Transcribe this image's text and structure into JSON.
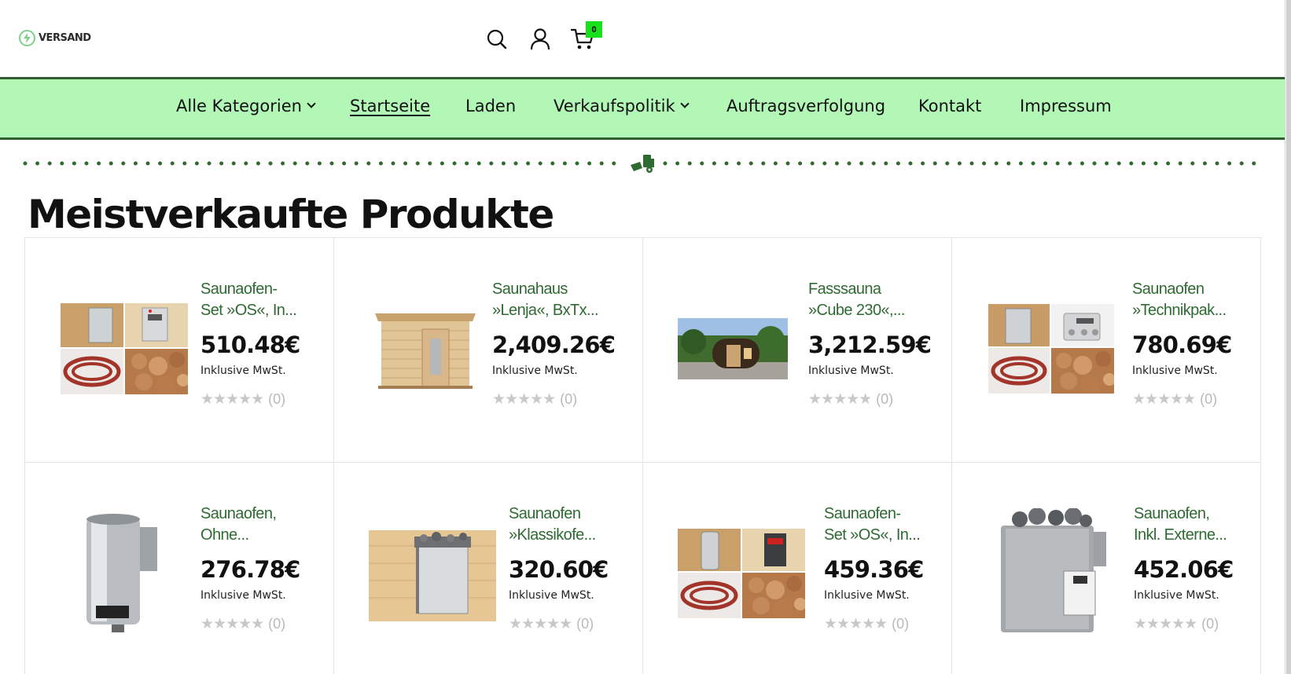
{
  "header": {
    "logo_text": "VERSAND",
    "cart_count": "0"
  },
  "nav": {
    "items": [
      {
        "label": "Alle Kategorien",
        "dropdown": true
      },
      {
        "label": "Startseite",
        "active": true
      },
      {
        "label": "Laden"
      },
      {
        "label": "Verkaufspolitik",
        "dropdown": true
      },
      {
        "label": "Auftragsverfolgung"
      },
      {
        "label": "Kontakt"
      },
      {
        "label": "Impressum"
      }
    ]
  },
  "section": {
    "title": "Meistverkaufte Produkte"
  },
  "products": [
    {
      "name": "Saunaofen-\nSet »OS«, In...",
      "price": "510.48€",
      "tax": "Inklusive MwSt.",
      "stars": "★★★★★",
      "reviews": "(0)"
    },
    {
      "name": "Saunahaus\n»Lenja«, BxTx...",
      "price": "2,409.26€",
      "tax": "Inklusive MwSt.",
      "stars": "★★★★★",
      "reviews": "(0)"
    },
    {
      "name": "Fasssauna\n»Cube 230«,...",
      "price": "3,212.59€",
      "tax": "Inklusive MwSt.",
      "stars": "★★★★★",
      "reviews": "(0)"
    },
    {
      "name": "Saunaofen\n»Technikpak...",
      "price": "780.69€",
      "tax": "Inklusive MwSt.",
      "stars": "★★★★★",
      "reviews": "(0)"
    },
    {
      "name": "Saunaofen,\nOhne...",
      "price": "276.78€",
      "tax": "Inklusive MwSt.",
      "stars": "★★★★★",
      "reviews": "(0)"
    },
    {
      "name": "Saunaofen\n»Klassikofe...",
      "price": "320.60€",
      "tax": "Inklusive MwSt.",
      "stars": "★★★★★",
      "reviews": "(0)"
    },
    {
      "name": "Saunaofen-\nSet »OS«, In...",
      "price": "459.36€",
      "tax": "Inklusive MwSt.",
      "stars": "★★★★★",
      "reviews": "(0)"
    },
    {
      "name": "Saunaofen,\nInkl. Externe...",
      "price": "452.06€",
      "tax": "Inklusive MwSt.",
      "stars": "★★★★★",
      "reviews": "(0)"
    }
  ],
  "colors": {
    "nav_bg": "#b2f7b6",
    "nav_border": "#2f5f31",
    "product_link": "#2f6a33",
    "cart_badge": "#18e01a"
  },
  "icons": [
    "search-icon",
    "account-icon",
    "cart-icon",
    "delivery-truck-icon",
    "chevron-down-icon",
    "star-icon"
  ]
}
